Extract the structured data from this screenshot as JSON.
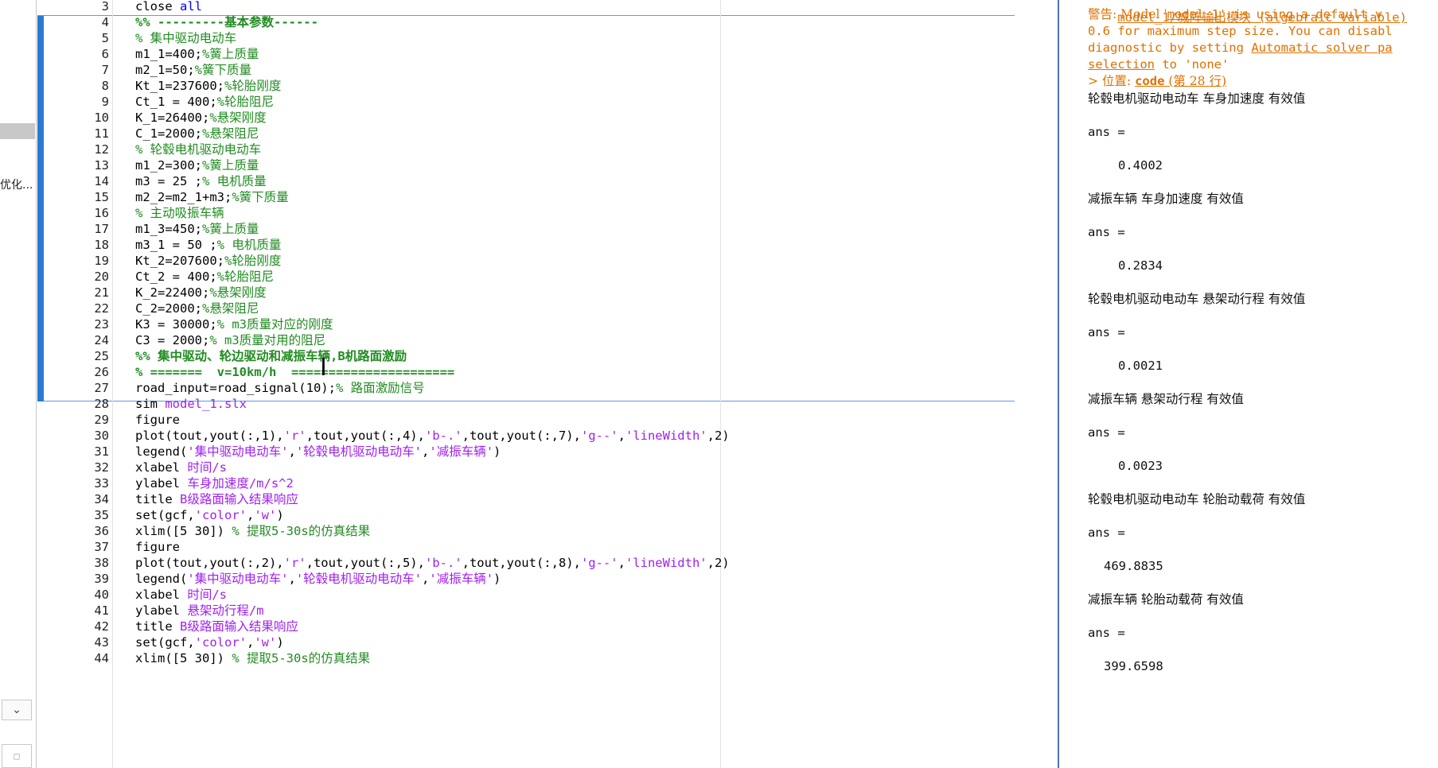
{
  "left_panel": {
    "truncated_label": "优化...",
    "dropdown_glyph": "⌄",
    "mini_button_glyph": "□"
  },
  "editor": {
    "lines": [
      {
        "n": "3",
        "parts": [
          [
            "",
            "close "
          ],
          [
            "kw",
            "all"
          ]
        ]
      },
      {
        "n": "4",
        "parts": [
          [
            "cmb",
            "%% ---------基本参数------"
          ]
        ]
      },
      {
        "n": "5",
        "parts": [
          [
            "cm",
            "% 集中驱动电动车"
          ]
        ]
      },
      {
        "n": "6",
        "parts": [
          [
            "",
            "m1_1=400;"
          ],
          [
            "cm",
            "%簧上质量"
          ]
        ]
      },
      {
        "n": "7",
        "parts": [
          [
            "",
            "m2_1=50;"
          ],
          [
            "cm",
            "%簧下质量"
          ]
        ]
      },
      {
        "n": "8",
        "parts": [
          [
            "",
            "Kt_1=237600;"
          ],
          [
            "cm",
            "%轮胎刚度"
          ]
        ]
      },
      {
        "n": "9",
        "parts": [
          [
            "",
            "Ct_1 = 400;"
          ],
          [
            "cm",
            "%轮胎阻尼"
          ]
        ]
      },
      {
        "n": "10",
        "parts": [
          [
            "",
            "K_1=26400;"
          ],
          [
            "cm",
            "%悬架刚度"
          ]
        ]
      },
      {
        "n": "11",
        "parts": [
          [
            "",
            "C_1=2000;"
          ],
          [
            "cm",
            "%悬架阻尼"
          ]
        ]
      },
      {
        "n": "12",
        "parts": [
          [
            "cm",
            "% 轮毂电机驱动电动车"
          ]
        ]
      },
      {
        "n": "13",
        "parts": [
          [
            "",
            "m1_2=300;"
          ],
          [
            "cm",
            "%簧上质量"
          ]
        ]
      },
      {
        "n": "14",
        "parts": [
          [
            "",
            "m3 = 25 ;"
          ],
          [
            "cm",
            "% 电机质量"
          ]
        ]
      },
      {
        "n": "15",
        "parts": [
          [
            "",
            "m2_2=m2_1+m3;"
          ],
          [
            "cm",
            "%簧下质量"
          ]
        ]
      },
      {
        "n": "16",
        "parts": [
          [
            "cm",
            "% 主动吸振车辆"
          ]
        ]
      },
      {
        "n": "17",
        "parts": [
          [
            "",
            "m1_3=450;"
          ],
          [
            "cm",
            "%簧上质量"
          ]
        ]
      },
      {
        "n": "18",
        "parts": [
          [
            "",
            "m3_1 = 50 ;"
          ],
          [
            "cm",
            "% 电机质量"
          ]
        ]
      },
      {
        "n": "19",
        "parts": [
          [
            "",
            "Kt_2=207600;"
          ],
          [
            "cm",
            "%轮胎刚度"
          ]
        ]
      },
      {
        "n": "20",
        "parts": [
          [
            "",
            "Ct_2 = 400;"
          ],
          [
            "cm",
            "%轮胎阻尼"
          ]
        ]
      },
      {
        "n": "21",
        "parts": [
          [
            "",
            "K_2=22400;"
          ],
          [
            "cm",
            "%悬架刚度"
          ]
        ]
      },
      {
        "n": "22",
        "parts": [
          [
            "",
            "C_2=2000;"
          ],
          [
            "cm",
            "%悬架阻尼"
          ]
        ]
      },
      {
        "n": "23",
        "parts": [
          [
            "",
            "K3 = 30000;"
          ],
          [
            "cm",
            "% m3质量对应的刚度"
          ]
        ]
      },
      {
        "n": "24",
        "parts": [
          [
            "",
            "C3 = 2000;"
          ],
          [
            "cm",
            "% m3质量对用的阻尼"
          ]
        ]
      },
      {
        "n": "25",
        "parts": [
          [
            "cmb",
            "%% 集中驱动、轮边驱动和减振车辆,B机路面激励"
          ]
        ]
      },
      {
        "n": "26",
        "parts": [
          [
            "cmb",
            "% =======  v=10km/h  ======================"
          ]
        ]
      },
      {
        "n": "27",
        "parts": [
          [
            "",
            "road_input=road_signal(10);"
          ],
          [
            "cm",
            "% 路面激励信号"
          ]
        ]
      },
      {
        "n": "28",
        "parts": [
          [
            "",
            "sim "
          ],
          [
            "str",
            "model_1.slx"
          ]
        ]
      },
      {
        "n": "29",
        "parts": [
          [
            "",
            "figure"
          ]
        ]
      },
      {
        "n": "30",
        "parts": [
          [
            "",
            "plot(tout,yout(:,1),"
          ],
          [
            "str",
            "'r'"
          ],
          [
            "",
            ",tout,yout(:,4),"
          ],
          [
            "str",
            "'b-.'"
          ],
          [
            "",
            ",tout,yout(:,7),"
          ],
          [
            "str",
            "'g--'"
          ],
          [
            "",
            ","
          ],
          [
            "str",
            "'lineWidth'"
          ],
          [
            "",
            ",2)"
          ]
        ]
      },
      {
        "n": "31",
        "parts": [
          [
            "",
            "legend("
          ],
          [
            "str",
            "'集中驱动电动车'"
          ],
          [
            "",
            ","
          ],
          [
            "str",
            "'轮毂电机驱动电动车'"
          ],
          [
            "",
            ","
          ],
          [
            "str",
            "'减振车辆'"
          ],
          [
            "",
            ")"
          ]
        ]
      },
      {
        "n": "32",
        "parts": [
          [
            "",
            "xlabel "
          ],
          [
            "str",
            "时间/s"
          ]
        ]
      },
      {
        "n": "33",
        "parts": [
          [
            "",
            "ylabel "
          ],
          [
            "str",
            "车身加速度/m/s^2"
          ]
        ]
      },
      {
        "n": "34",
        "parts": [
          [
            "",
            "title "
          ],
          [
            "str",
            "B级路面输入结果响应"
          ]
        ]
      },
      {
        "n": "35",
        "parts": [
          [
            "",
            "set(gcf,"
          ],
          [
            "str",
            "'color'"
          ],
          [
            "",
            ","
          ],
          [
            "str",
            "'w'"
          ],
          [
            "",
            ")"
          ]
        ]
      },
      {
        "n": "36",
        "parts": [
          [
            "",
            "xlim([5 30]) "
          ],
          [
            "cm",
            "% 提取5-30s的仿真结果"
          ]
        ]
      },
      {
        "n": "37",
        "parts": [
          [
            "",
            "figure"
          ]
        ]
      },
      {
        "n": "38",
        "parts": [
          [
            "",
            "plot(tout,yout(:,2),"
          ],
          [
            "str",
            "'r'"
          ],
          [
            "",
            ",tout,yout(:,5),"
          ],
          [
            "str",
            "'b-.'"
          ],
          [
            "",
            ",tout,yout(:,8),"
          ],
          [
            "str",
            "'g--'"
          ],
          [
            "",
            ","
          ],
          [
            "str",
            "'lineWidth'"
          ],
          [
            "",
            ",2)"
          ]
        ]
      },
      {
        "n": "39",
        "parts": [
          [
            "",
            "legend("
          ],
          [
            "str",
            "'集中驱动电动车'"
          ],
          [
            "",
            ","
          ],
          [
            "str",
            "'轮毂电机驱动电动车'"
          ],
          [
            "",
            ","
          ],
          [
            "str",
            "'减振车辆'"
          ],
          [
            "",
            ")"
          ]
        ]
      },
      {
        "n": "40",
        "parts": [
          [
            "",
            "xlabel "
          ],
          [
            "str",
            "时间/s"
          ]
        ]
      },
      {
        "n": "41",
        "parts": [
          [
            "",
            "ylabel "
          ],
          [
            "str",
            "悬架动行程/m"
          ]
        ]
      },
      {
        "n": "42",
        "parts": [
          [
            "",
            "title "
          ],
          [
            "str",
            "B级路面输入结果响应"
          ]
        ]
      },
      {
        "n": "43",
        "parts": [
          [
            "",
            "set(gcf,"
          ],
          [
            "str",
            "'color'"
          ],
          [
            "",
            ","
          ],
          [
            "str",
            "'w'"
          ],
          [
            "",
            ")"
          ]
        ]
      },
      {
        "n": "44",
        "parts": [
          [
            "",
            "xlim([5 30]) "
          ],
          [
            "cm",
            "% 提取5-30s的仿真结果"
          ]
        ]
      }
    ],
    "colors": {
      "keyword": "#0000ff",
      "comment": "#228b22",
      "string": "#a020f0",
      "section_bar": "#2a7ad2"
    },
    "cursor_glyph": "I"
  },
  "command_window": {
    "top_partial": "model_1/城阵输出模块 (algebraic variable)",
    "warning": {
      "line1_prefix": "警告: Model '",
      "line1_link": "model_1",
      "line1_suffix": "' is using a default v",
      "line2": "0.6 for maximum step size. You can disabl",
      "line3_prefix": "diagnostic by setting ",
      "line3_link": "Automatic solver pa",
      "line4_link": "selection",
      "line4_suffix": " to 'none'",
      "location_prefix": "> 位置: ",
      "location_link": "code",
      "location_suffix": " (第 28 行)"
    },
    "results": [
      {
        "label": "轮毂电机驱动电动车 车身加速度 有效值",
        "ans": "ans =",
        "value": "0.4002"
      },
      {
        "label": "减振车辆 车身加速度 有效值",
        "ans": "ans =",
        "value": "0.2834"
      },
      {
        "label": "轮毂电机驱动电动车 悬架动行程 有效值",
        "ans": "ans =",
        "value": "0.0021"
      },
      {
        "label": "减振车辆 悬架动行程 有效值",
        "ans": "ans =",
        "value": "0.0023"
      },
      {
        "label": "轮毂电机驱动电动车 轮胎动载荷 有效值",
        "ans": "ans =",
        "value": "469.8835"
      },
      {
        "label": "减振车辆 轮胎动载荷 有效值",
        "ans": "ans =",
        "value": "399.6598"
      }
    ],
    "warning_color": "#e07000"
  }
}
